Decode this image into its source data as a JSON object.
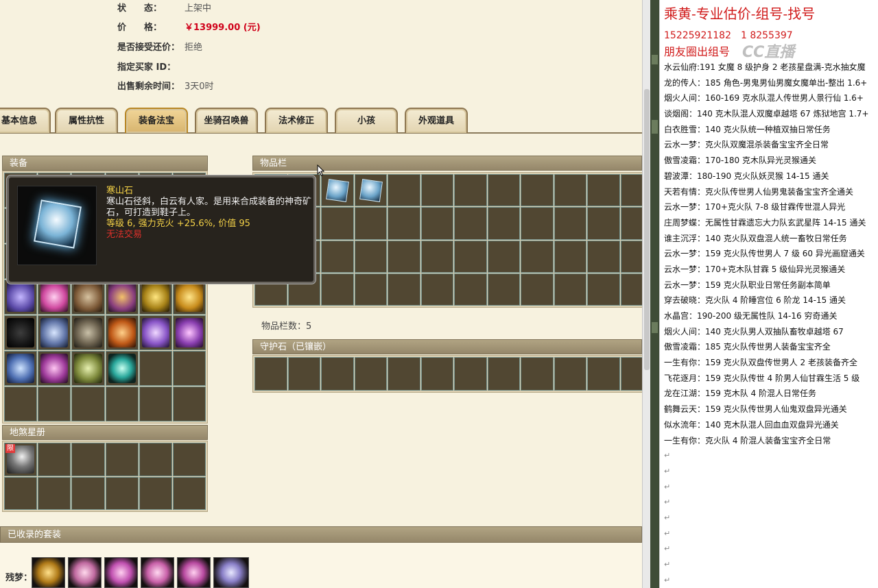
{
  "listing": {
    "status_label": "状　　态：",
    "status_value": "上架中",
    "price_label": "价　　格：",
    "price_value": "￥13999.00 (元)",
    "counter_label": "是否接受还价：",
    "counter_value": "拒绝",
    "buyer_label": "指定买家 ID：",
    "buyer_value": "",
    "time_label": "出售剩余时间：",
    "time_value": "3天0时"
  },
  "tabs": [
    "基本信息",
    "属性抗性",
    "装备法宝",
    "坐骑召唤兽",
    "法术修正",
    "小孩",
    "外观道具"
  ],
  "active_tab": "装备法宝",
  "panels": {
    "equip_title": "装备",
    "items_title": "物品栏",
    "items_count": "物品栏数：5",
    "guard_title": "守护石（已镶嵌）",
    "star_title": "地煞星册",
    "star_tag": "限",
    "suit_title": "已收录的套装",
    "suit_label": "残梦："
  },
  "tooltip": {
    "name": "寒山石",
    "desc": "寒山石径斜，白云有人家。是用来合成装备的神奇矿石，可打造到鞋子上。",
    "stat": "等级 6, 强力克火 +25.6%, 价值 95",
    "trade": "无法交易"
  },
  "sidebar": {
    "title": "乘黄-专业估价-组号-找号",
    "phone": "15225921182　1 8255397",
    "subtitle": "朋友圈出组号",
    "logo": "CC直播",
    "lines": [
      "水云仙府:191 女魔 8 级护身 2 老孩星盘满-克水抽女魔",
      "龙的传人：185 角色-男鬼男仙男魔女魔单出-整出 1.6+",
      "烟火人间：160-169 克水队混人传世男人景行仙 1.6+",
      "谈烟阁：140 克木队混人双魔卓越塔 67 炼狱地宫 1.7+",
      "白衣胜雪：140 克火队统一种植双抽日常任务",
      "云水一梦：克火队双魔混杀装备宝宝齐全日常",
      "傲雪凌霜：170-180 克木队异光灵猴通关",
      "碧波潭：180-190 克火队妖灵猴 14-15 通关",
      "天若有情：克火队传世男人仙男鬼装备宝宝齐全通关",
      "云水一梦：170+克火队 7-8 级甘霖传世混人异光",
      "庄周梦蝶：无属性甘霖遗忘大力队玄武星阵 14-15 通关",
      "谁主沉浮：140 克火队双盘混人统一畜牧日常任务",
      "云水一梦：159 克火队传世男人 7 级 60 异光画窟通关",
      "云水一梦：170+克木队甘霖 5 级仙异光灵猴通关",
      "云水一梦：159 克火队职业日常任务副本简单",
      "穿去破晓：克火队 4 阶睡宫位 6 阶龙 14-15 通关",
      "水晶宫：190-200 级无属性队 14-16 穷奇通关",
      "烟火人间：140 克火队男人双抽队畜牧卓越塔 67",
      "傲雪凌霜：185 克火队传世男人装备宝宝齐全",
      "一生有你：159 克火队双盘传世男人 2 老孩装备齐全",
      "飞花逐月：159 克火队传世 4 阶男人仙甘霖生活 5 级",
      "龙在江湖：159 克木队 4 阶混人日常任务",
      "鹤舞云天：159 克火队传世男人仙鬼双盘异光通关",
      "似水流年：140 克木队混人回血血双盘异光通关",
      "一生有你：克火队 4 阶混人装备宝宝齐全日常"
    ],
    "return_mark": "↵"
  }
}
